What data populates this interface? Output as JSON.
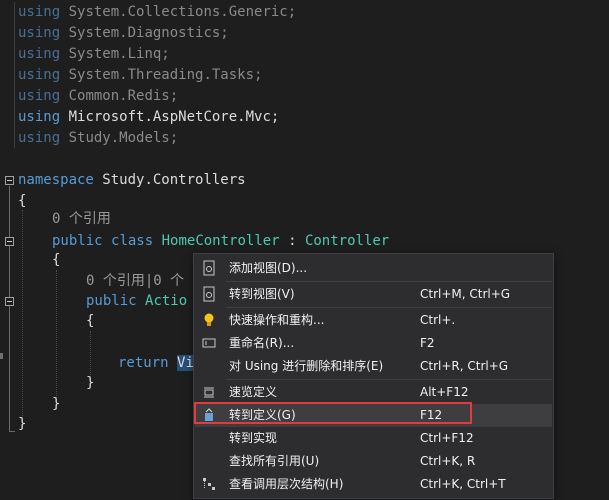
{
  "colors": {
    "background": "#1e1e1e",
    "keyword": "#569cd6",
    "type": "#4ec9b0",
    "text": "#dcdcdc",
    "codelens": "#999999",
    "menu_bg": "#2d2d30",
    "highlight_border": "#e03c3c"
  },
  "code": {
    "using_lines": [
      {
        "kw": "using",
        "ns": "System.Collections.Generic;"
      },
      {
        "kw": "using",
        "ns": "System.Diagnostics;"
      },
      {
        "kw": "using",
        "ns": "System.Linq;"
      },
      {
        "kw": "using",
        "ns": "System.Threading.Tasks;"
      },
      {
        "kw": "using",
        "ns": "Common.Redis;"
      },
      {
        "kw": "using",
        "ns": "Microsoft.AspNetCore.Mvc;"
      },
      {
        "kw": "using",
        "ns": "Study.Models;"
      }
    ],
    "namespace_kw": "namespace",
    "namespace_name": "Study.Controllers",
    "brace_open": "{",
    "brace_close": "}",
    "class_lens": "0 个引用",
    "class_public": "public",
    "class_kw": "class",
    "class_name": "HomeController",
    "class_colon": ":",
    "class_base": "Controller",
    "method_lens": "0 个引用|0 个",
    "method_public": "public",
    "method_type": "Actio",
    "return_kw": "return",
    "return_expr": "Vi"
  },
  "context_menu": {
    "items": [
      {
        "icon": "add-view-icon",
        "label": "添加视图(D)...",
        "shortcut": ""
      },
      {
        "icon": "go-to-view-icon",
        "label": "转到视图(V)",
        "shortcut": "Ctrl+M, Ctrl+G"
      },
      {
        "icon": "lightbulb-icon",
        "label": "快速操作和重构...",
        "shortcut": "Ctrl+."
      },
      {
        "icon": "rename-icon",
        "label": "重命名(R)...",
        "shortcut": "F2"
      },
      {
        "icon": "",
        "label": "对 Using 进行删除和排序(E)",
        "shortcut": "Ctrl+R, Ctrl+G"
      },
      {
        "icon": "peek-definition-icon",
        "label": "速览定义",
        "shortcut": "Alt+F12"
      },
      {
        "icon": "go-to-definition-icon",
        "label": "转到定义(G)",
        "shortcut": "F12"
      },
      {
        "icon": "",
        "label": "转到实现",
        "shortcut": "Ctrl+F12"
      },
      {
        "icon": "",
        "label": "查找所有引用(U)",
        "shortcut": "Ctrl+K, R"
      },
      {
        "icon": "call-hierarchy-icon",
        "label": "查看调用层次结构(H)",
        "shortcut": "Ctrl+K, Ctrl+T"
      }
    ]
  }
}
